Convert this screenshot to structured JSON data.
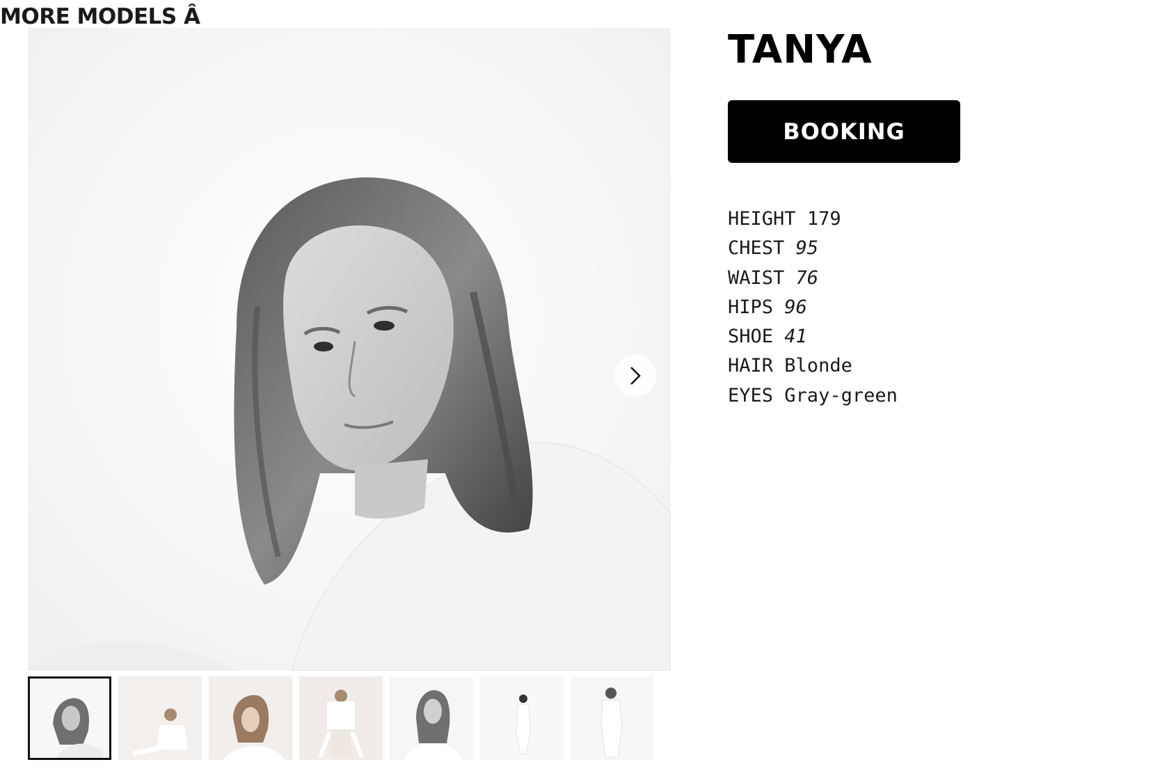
{
  "nav": {
    "more_models": "MORE MODELS Â"
  },
  "model": {
    "name": "TANYA",
    "booking_label": "BOOKING",
    "specs": [
      {
        "label": "HEIGHT",
        "value": "179"
      },
      {
        "label": "CHEST",
        "value": "95"
      },
      {
        "label": "WAIST",
        "value": "76"
      },
      {
        "label": "HIPS",
        "value": "96"
      },
      {
        "label": "SHOE",
        "value": "41"
      },
      {
        "label": "HAIR",
        "value": "Blonde"
      },
      {
        "label": "EYES",
        "value": "Gray-green"
      }
    ]
  },
  "gallery": {
    "next_icon": "chevron-right-icon",
    "thumbnail_count": 7,
    "active_index": 0
  },
  "colors": {
    "accent": "#000000",
    "button_text": "#ffffff",
    "background": "#ffffff"
  }
}
